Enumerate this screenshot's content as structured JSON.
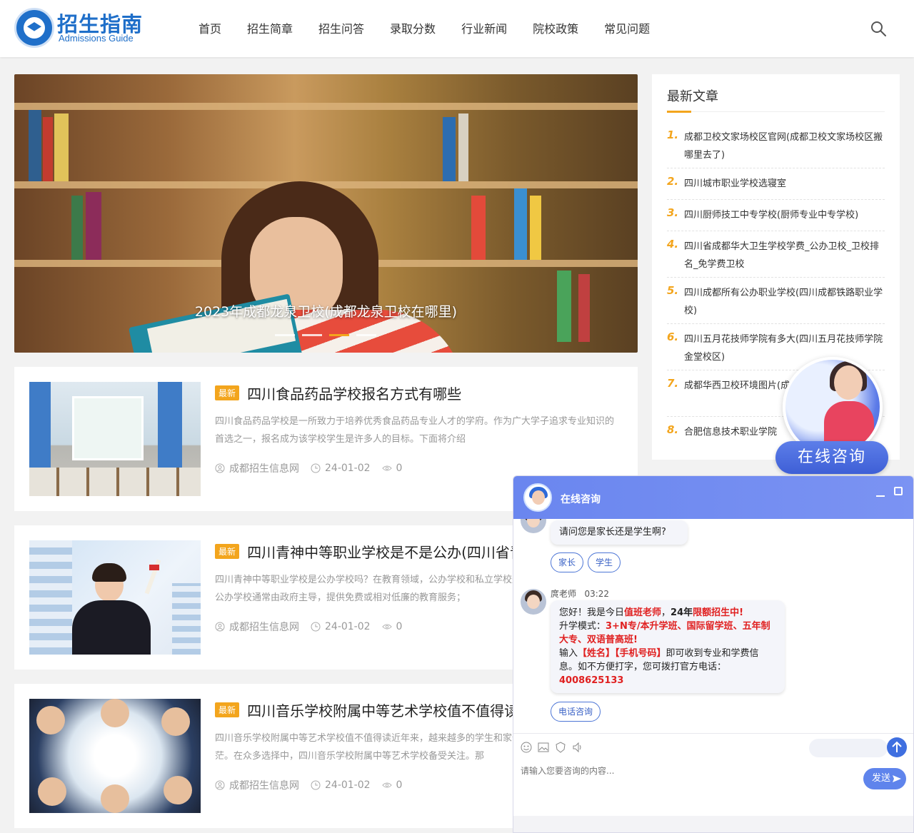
{
  "header": {
    "logo_title": "招生指南",
    "logo_subtitle": "Admissions Guide",
    "nav": [
      "首页",
      "招生简章",
      "招生问答",
      "录取分数",
      "行业新闻",
      "院校政策",
      "常见问题"
    ]
  },
  "hero": {
    "caption": "2023年成都龙泉卫校(成都龙泉卫校在哪里)",
    "slides": 4,
    "active_slide": 3
  },
  "articles": [
    {
      "badge": "最新",
      "title": "四川食品药品学校报名方式有哪些",
      "excerpt": "四川食品药品学校是一所致力于培养优秀食品药品专业人才的学府。作为广大学子追求专业知识的首选之一，报名成为该学校学生是许多人的目标。下面将介绍",
      "author": "成都招生信息网",
      "date": "24-01-02",
      "views": "0"
    },
    {
      "badge": "最新",
      "title": "四川青神中等职业学校是不是公办(四川省青神中等职业学校)",
      "excerpt": "四川青神中等职业学校是公办学校吗？在教育领域，公办学校和私立学校是两种不同的办学类型。公办学校通常由政府主导，提供免费或相对低廉的教育服务；",
      "author": "成都招生信息网",
      "date": "24-01-02",
      "views": "0"
    },
    {
      "badge": "最新",
      "title": "四川音乐学校附属中等艺术学校值不值得读",
      "excerpt": "四川音乐学校附属中等艺术学校值不值得读近年来，越来越多的学生和家长在选择学校时感到迷茫。在众多选择中，四川音乐学校附属中等艺术学校备受关注。那",
      "author": "成都招生信息网",
      "date": "24-01-02",
      "views": "0"
    }
  ],
  "sidebar": {
    "title": "最新文章",
    "items": [
      {
        "num": "1.",
        "text": "成都卫校文家场校区官网(成都卫校文家场校区搬哪里去了)"
      },
      {
        "num": "2.",
        "text": "四川城市职业学校选寝室"
      },
      {
        "num": "3.",
        "text": "四川厨师技工中专学校(厨师专业中专学校)"
      },
      {
        "num": "4.",
        "text": "四川省成都华大卫生学校学费_公办卫校_卫校排名_免学费卫校"
      },
      {
        "num": "5.",
        "text": "四川成都所有公办职业学校(四川成都铁路职业学校)"
      },
      {
        "num": "6.",
        "text": "四川五月花技师学院有多大(四川五月花技师学院金堂校区)"
      },
      {
        "num": "7.",
        "text": "成都华西卫校环境图片(成都华西卫校招生热线)"
      },
      {
        "num": "8.",
        "text": "合肥信息技术职业学院"
      }
    ]
  },
  "float_consult": {
    "label": "在线咨询"
  },
  "chat": {
    "title": "在线咨询",
    "question": "请问您是家长还是学生啊?",
    "chips": [
      "家长",
      "学生"
    ],
    "agent_name": "庹老师",
    "agent_time": "03:22",
    "msg": {
      "p1a": "您好！我是今日",
      "p1b": "值班老师",
      "p1c": "，",
      "p1d": "24年",
      "p1e": "限额招生中!",
      "p2a": "升学模式：",
      "p2b": "3+N专/本升学班、国际留学班、五年制大专、双语普高班!",
      "p3a": "输入",
      "p3b": "【姓名】【手机号码】",
      "p3c": "即可收到专业和学费信息。如不方便打字，您可拨打官方电话：",
      "phone": "4008625133"
    },
    "phone_chip": "电话咨询",
    "input_placeholder": "请输入您要咨询的内容...",
    "send_label": "发送"
  },
  "colors": {
    "brand_blue": "#1f6fc9",
    "accent_orange": "#f3a51d",
    "chat_blue": "#6a86ef",
    "highlight_red": "#e02020"
  }
}
